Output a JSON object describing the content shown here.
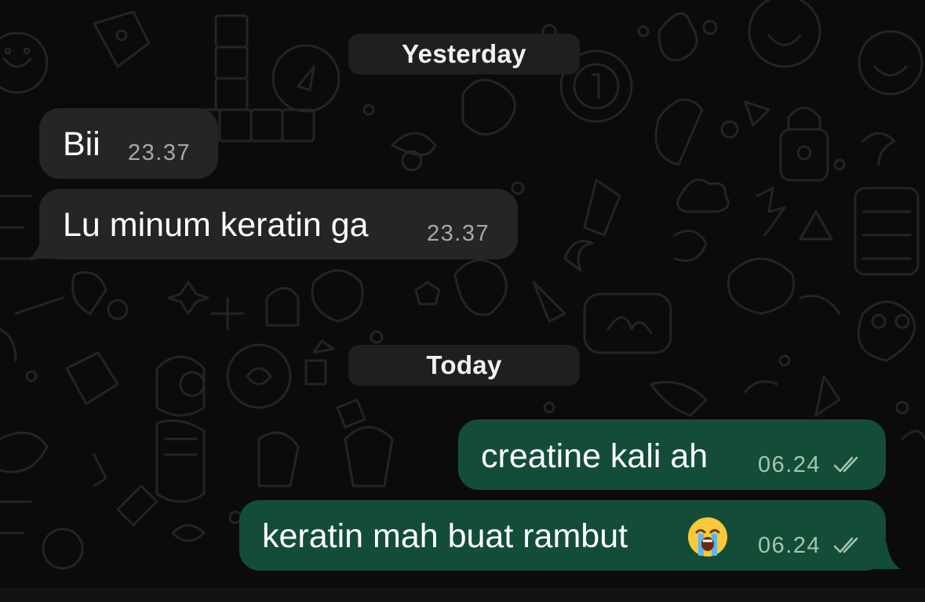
{
  "chat": {
    "day_separators": [
      "Yesterday",
      "Today"
    ],
    "messages": [
      {
        "direction": "incoming",
        "text": "Bii",
        "time": "23.37"
      },
      {
        "direction": "incoming",
        "text": "Lu minum keratin ga",
        "time": "23.37"
      },
      {
        "direction": "outgoing",
        "text": "creatine kali ah",
        "time": "06.24",
        "status": "read-double-check"
      },
      {
        "direction": "outgoing",
        "text": "keratin mah buat rambut",
        "emoji": "loudly-crying-face",
        "time": "06.24",
        "status": "read-double-check"
      }
    ]
  },
  "colors": {
    "background": "#0b0b0b",
    "incoming_bubble": "#252525",
    "outgoing_bubble": "#144d37",
    "date_chip": "#1f1f1f"
  }
}
